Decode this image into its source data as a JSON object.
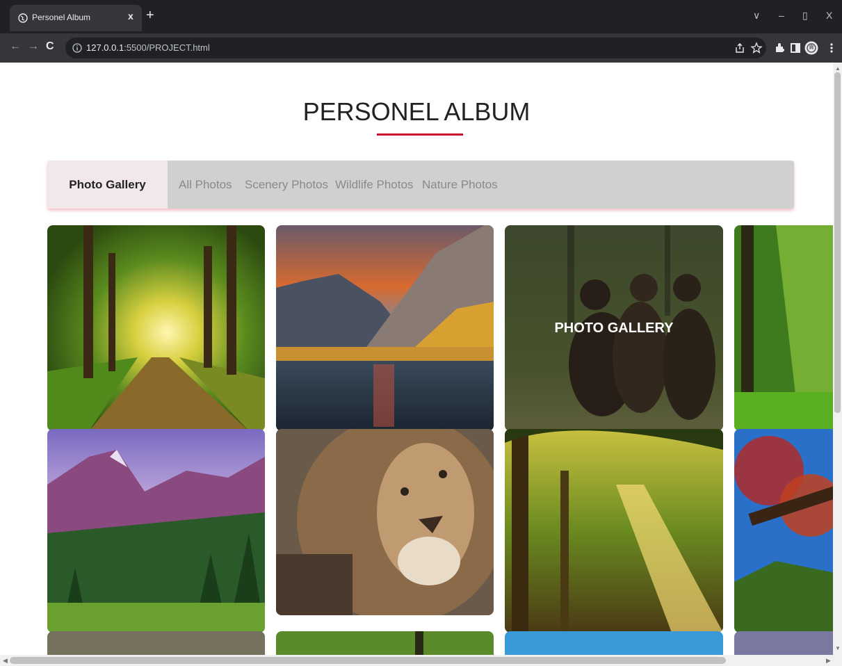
{
  "browser": {
    "tab_title": "Personel Album",
    "tab_close": "x",
    "new_tab": "+",
    "url_host": "127.0.0.1",
    "url_rest": ":5500/PROJECT.html",
    "window_controls": {
      "dropdown": "∨",
      "minimize": "–",
      "maximize": "▯",
      "close": "X"
    },
    "nav": {
      "back": "←",
      "forward": "→",
      "reload": "C"
    },
    "icons": [
      "share-icon",
      "star-icon",
      "extensions-icon",
      "sidebar-icon",
      "profile-avatar-icon",
      "kebab-menu-icon"
    ]
  },
  "page": {
    "title": "PERSONEL ALBUM",
    "accent_color": "#c8102e",
    "nav": {
      "active": "Photo Gallery",
      "items": [
        "All Photos",
        "Scenery Photos",
        "Wildlife Photos",
        "Nature Photos"
      ]
    },
    "photos": [
      {
        "name": "forest-path-sunlight",
        "overlay_text": ""
      },
      {
        "name": "mountain-lake-sunset",
        "overlay_text": ""
      },
      {
        "name": "bear-cubs",
        "overlay_text": "PHOTO GALLERY"
      },
      {
        "name": "sunlit-forest",
        "overlay_text": ""
      },
      {
        "name": "purple-mountains-pines",
        "overlay_text": ""
      },
      {
        "name": "lion-portrait",
        "overlay_text": ""
      },
      {
        "name": "forest-light-rays",
        "overlay_text": ""
      },
      {
        "name": "autumn-tree-blue-sky",
        "overlay_text": ""
      }
    ]
  }
}
